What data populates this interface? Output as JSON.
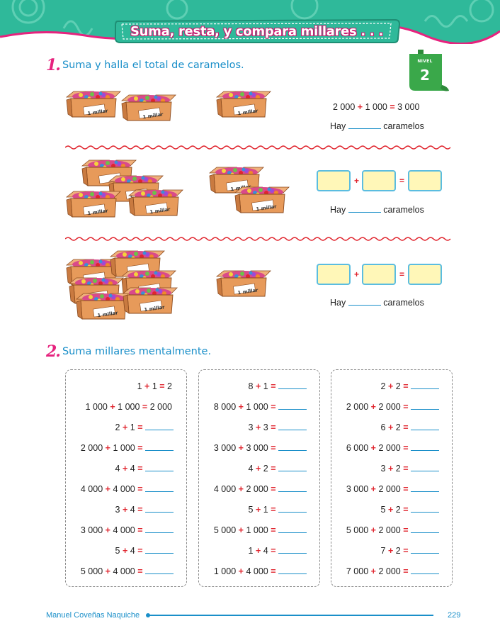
{
  "header": {
    "title": "Suma, resta, y compara millares . . ."
  },
  "nivel": {
    "label": "NIVEL",
    "number": "2"
  },
  "exercise1": {
    "number": "1.",
    "instruction": "Suma y halla el total de caramelos.",
    "box_label": "1 millar",
    "row1": {
      "equation": {
        "a": "2 000",
        "op": "+",
        "b": "1 000",
        "eq": "=",
        "result": "3 000"
      }
    },
    "plus_sign": "+",
    "equals_sign": "=",
    "hay": "Hay",
    "caramelos": "caramelos"
  },
  "exercise2": {
    "number": "2.",
    "instruction": "Suma millares mentalmente.",
    "columns": [
      [
        {
          "a": "1",
          "b": "1",
          "result": "2"
        },
        {
          "a": "1 000",
          "b": "1 000",
          "result": "2 000"
        },
        {
          "a": "2",
          "b": "1",
          "result": ""
        },
        {
          "a": "2 000",
          "b": "1 000",
          "result": ""
        },
        {
          "a": "4",
          "b": "4",
          "result": ""
        },
        {
          "a": "4 000",
          "b": "4 000",
          "result": ""
        },
        {
          "a": "3",
          "b": "4",
          "result": ""
        },
        {
          "a": "3 000",
          "b": "4 000",
          "result": ""
        },
        {
          "a": "5",
          "b": "4",
          "result": ""
        },
        {
          "a": "5 000",
          "b": "4 000",
          "result": ""
        }
      ],
      [
        {
          "a": "8",
          "b": "1",
          "result": ""
        },
        {
          "a": "8 000",
          "b": "1 000",
          "result": ""
        },
        {
          "a": "3",
          "b": "3",
          "result": ""
        },
        {
          "a": "3 000",
          "b": "3 000",
          "result": ""
        },
        {
          "a": "4",
          "b": "2",
          "result": ""
        },
        {
          "a": "4 000",
          "b": "2 000",
          "result": ""
        },
        {
          "a": "5",
          "b": "1",
          "result": ""
        },
        {
          "a": "5 000",
          "b": "1 000",
          "result": ""
        },
        {
          "a": "1",
          "b": "4",
          "result": ""
        },
        {
          "a": "1 000",
          "b": "4 000",
          "result": ""
        }
      ],
      [
        {
          "a": "2",
          "b": "2",
          "result": ""
        },
        {
          "a": "2 000",
          "b": "2 000",
          "result": ""
        },
        {
          "a": "6",
          "b": "2",
          "result": ""
        },
        {
          "a": "6 000",
          "b": "2 000",
          "result": ""
        },
        {
          "a": "3",
          "b": "2",
          "result": ""
        },
        {
          "a": "3 000",
          "b": "2 000",
          "result": ""
        },
        {
          "a": "5",
          "b": "2",
          "result": ""
        },
        {
          "a": "5 000",
          "b": "2 000",
          "result": ""
        },
        {
          "a": "7",
          "b": "2",
          "result": ""
        },
        {
          "a": "7 000",
          "b": "2 000",
          "result": ""
        }
      ]
    ],
    "plus": "+",
    "equals": "="
  },
  "footer": {
    "author": "Manuel Coveñas Naquiche",
    "page": "229"
  },
  "colors": {
    "teal": "#2fb99a",
    "pink": "#e6237e",
    "blue": "#1a8fc9",
    "red": "#e0252e",
    "box_fill": "#e79a5a",
    "answer_box": "#fff7b8",
    "nivel_green": "#3aa84a"
  }
}
